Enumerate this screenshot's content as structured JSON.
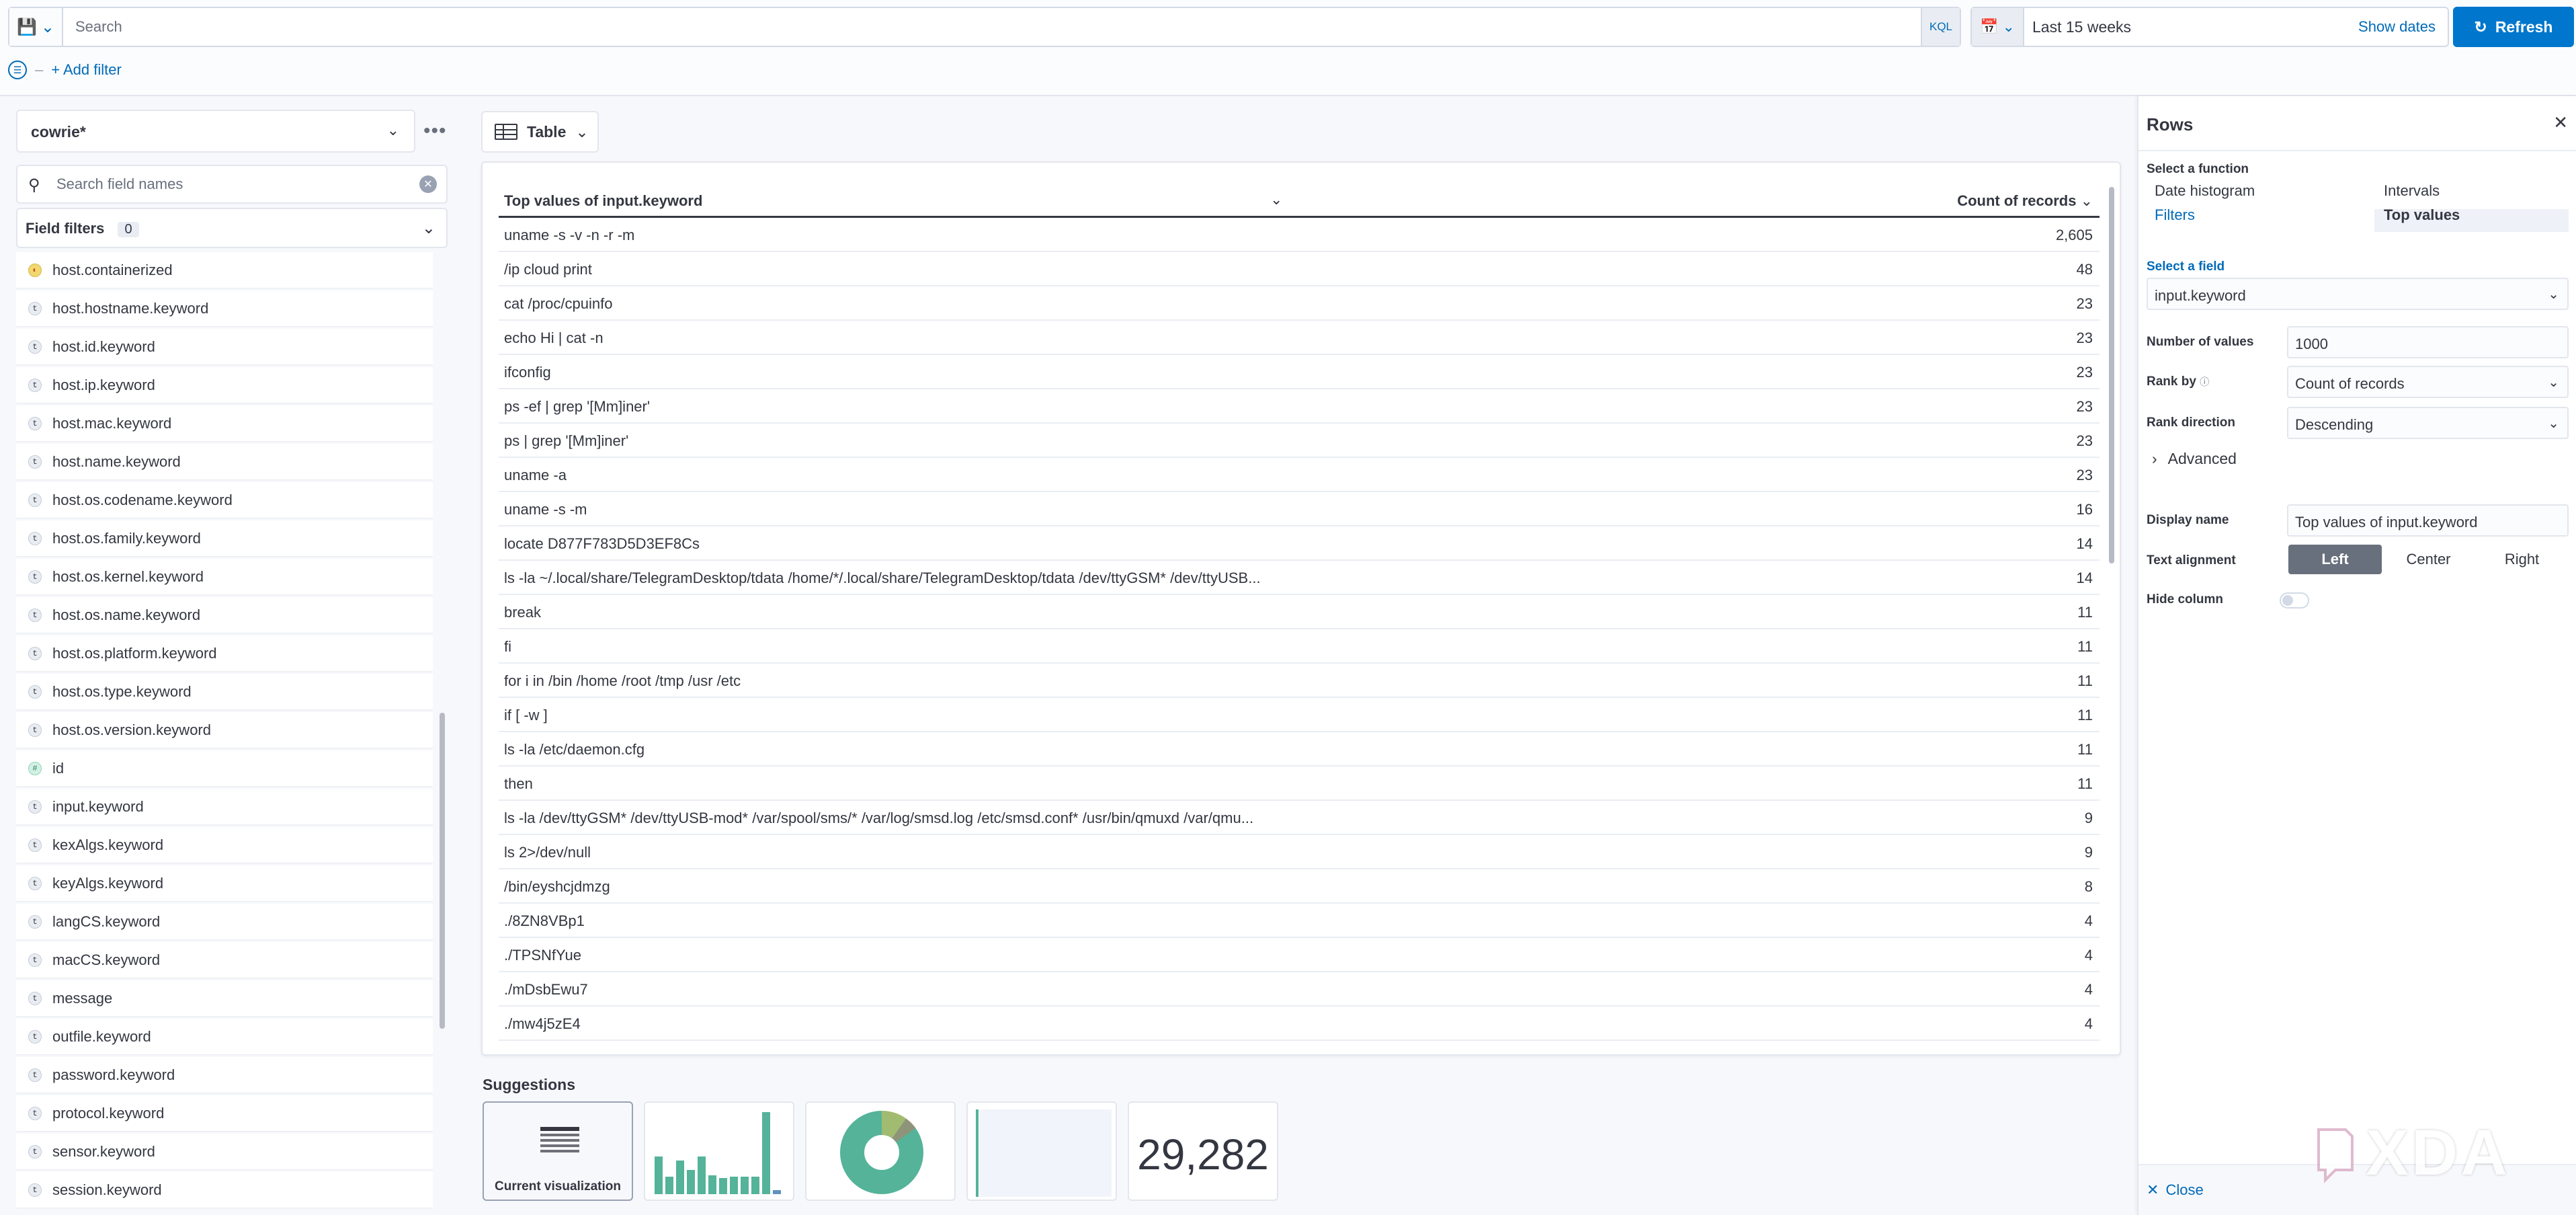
{
  "query": {
    "placeholder": "Search",
    "language": "KQL"
  },
  "time": {
    "range_label": "Last 15 weeks",
    "show_dates": "Show dates",
    "refresh": "Refresh"
  },
  "filters": {
    "add_filter": "+ Add filter"
  },
  "sidebar": {
    "data_view": "cowrie*",
    "search_placeholder": "Search field names",
    "field_filters_label": "Field filters",
    "field_filters_count": "0",
    "fields": [
      {
        "name": "host.containerized",
        "type": "boolean"
      },
      {
        "name": "host.hostname.keyword",
        "type": "string"
      },
      {
        "name": "host.id.keyword",
        "type": "string"
      },
      {
        "name": "host.ip.keyword",
        "type": "string"
      },
      {
        "name": "host.mac.keyword",
        "type": "string"
      },
      {
        "name": "host.name.keyword",
        "type": "string"
      },
      {
        "name": "host.os.codename.keyword",
        "type": "string"
      },
      {
        "name": "host.os.family.keyword",
        "type": "string"
      },
      {
        "name": "host.os.kernel.keyword",
        "type": "string"
      },
      {
        "name": "host.os.name.keyword",
        "type": "string"
      },
      {
        "name": "host.os.platform.keyword",
        "type": "string"
      },
      {
        "name": "host.os.type.keyword",
        "type": "string"
      },
      {
        "name": "host.os.version.keyword",
        "type": "string"
      },
      {
        "name": "id",
        "type": "number"
      },
      {
        "name": "input.keyword",
        "type": "string"
      },
      {
        "name": "kexAlgs.keyword",
        "type": "string"
      },
      {
        "name": "keyAlgs.keyword",
        "type": "string"
      },
      {
        "name": "langCS.keyword",
        "type": "string"
      },
      {
        "name": "macCS.keyword",
        "type": "string"
      },
      {
        "name": "message",
        "type": "string"
      },
      {
        "name": "outfile.keyword",
        "type": "string"
      },
      {
        "name": "password.keyword",
        "type": "string"
      },
      {
        "name": "protocol.keyword",
        "type": "string"
      },
      {
        "name": "sensor.keyword",
        "type": "string"
      },
      {
        "name": "session.keyword",
        "type": "string"
      }
    ]
  },
  "workspace": {
    "viz_type": "Table",
    "table": {
      "col1": "Top values of input.keyword",
      "col2": "Count of records",
      "rows": [
        {
          "value": "uname -s -v -n -r -m",
          "count": "2,605"
        },
        {
          "value": "/ip cloud print",
          "count": "48"
        },
        {
          "value": "cat /proc/cpuinfo",
          "count": "23"
        },
        {
          "value": "echo Hi | cat -n",
          "count": "23"
        },
        {
          "value": "ifconfig",
          "count": "23"
        },
        {
          "value": "ps -ef | grep '[Mm]iner'",
          "count": "23"
        },
        {
          "value": "ps | grep '[Mm]iner'",
          "count": "23"
        },
        {
          "value": "uname -a",
          "count": "23"
        },
        {
          "value": "uname -s -m",
          "count": "16"
        },
        {
          "value": "locate D877F783D5D3EF8Cs",
          "count": "14"
        },
        {
          "value": "ls -la ~/.local/share/TelegramDesktop/tdata /home/*/.local/share/TelegramDesktop/tdata /dev/ttyGSM* /dev/ttyUSB...",
          "count": "14"
        },
        {
          "value": "break",
          "count": "11"
        },
        {
          "value": "fi",
          "count": "11"
        },
        {
          "value": "for i in /bin /home /root /tmp /usr /etc",
          "count": "11"
        },
        {
          "value": "if [ -w ]",
          "count": "11"
        },
        {
          "value": "ls -la /etc/daemon.cfg",
          "count": "11"
        },
        {
          "value": "then",
          "count": "11"
        },
        {
          "value": "ls -la /dev/ttyGSM* /dev/ttyUSB-mod* /var/spool/sms/* /var/log/smsd.log /etc/smsd.conf* /usr/bin/qmuxd /var/qmu...",
          "count": "9"
        },
        {
          "value": "ls 2>/dev/null",
          "count": "9"
        },
        {
          "value": "/bin/eyshcjdmzg",
          "count": "8"
        },
        {
          "value": "./8ZN8VBp1",
          "count": "4"
        },
        {
          "value": "./TPSNfYue",
          "count": "4"
        },
        {
          "value": "./mDsbEwu7",
          "count": "4"
        },
        {
          "value": "./mw4j5zE4",
          "count": "4"
        }
      ]
    },
    "suggestions": {
      "title": "Suggestions",
      "current_label": "Current visualization",
      "metric_value": "29,282"
    }
  },
  "flyout": {
    "title": "Rows",
    "select_function_label": "Select a function",
    "functions": {
      "date_histogram": "Date histogram",
      "intervals": "Intervals",
      "filters": "Filters",
      "top_values": "Top values"
    },
    "select_field_label": "Select a field",
    "field_value": "input.keyword",
    "number_of_values_label": "Number of values",
    "number_of_values": "1000",
    "rank_by_label": "Rank by",
    "rank_by": "Count of records",
    "rank_direction_label": "Rank direction",
    "rank_direction": "Descending",
    "advanced": "Advanced",
    "display_name_label": "Display name",
    "display_name": "Top values of input.keyword",
    "text_alignment_label": "Text alignment",
    "alignment": {
      "left": "Left",
      "center": "Center",
      "right": "Right"
    },
    "hide_column_label": "Hide column",
    "close": "Close"
  },
  "colors": {
    "accent": "#0077cc",
    "link": "#006bb8",
    "chart_green": "#54b399"
  }
}
